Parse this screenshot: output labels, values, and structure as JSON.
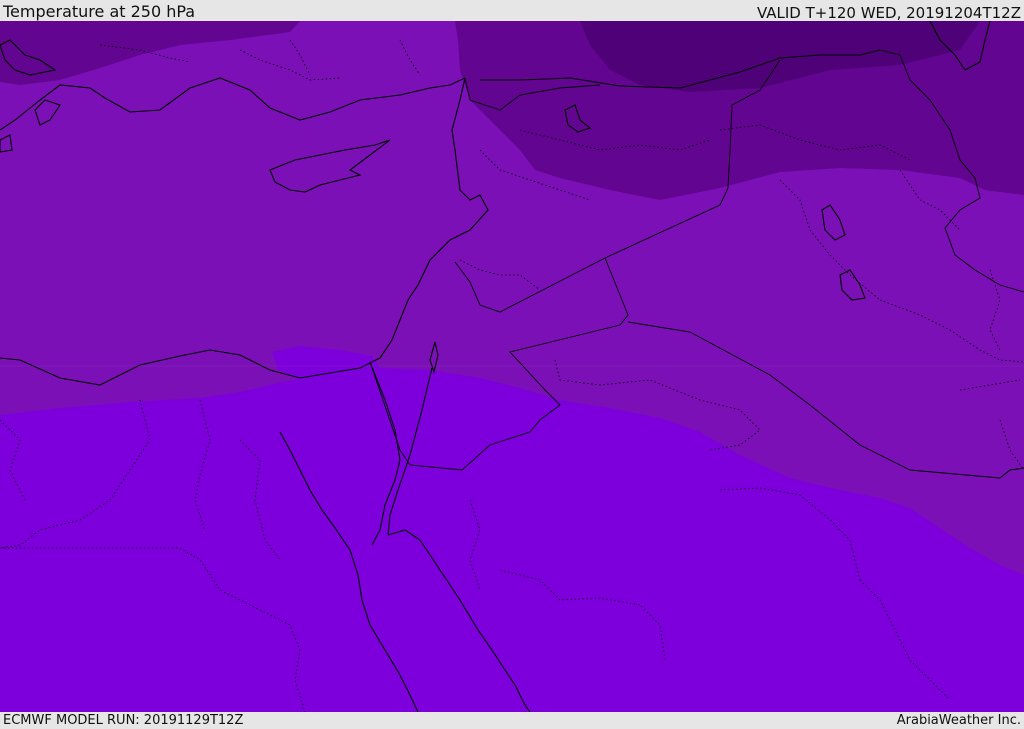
{
  "header": {
    "title": "Temperature at 250 hPa",
    "valid": "VALID T+120 WED, 20191204T12Z"
  },
  "footer": {
    "model_run": "ECMWF MODEL RUN: 20191129T12Z",
    "credit": "ArabiaWeather Inc."
  },
  "map": {
    "field": "temperature_250hPa",
    "region": "Eastern Mediterranean / Middle East",
    "colors": {
      "coldest": "#4f0278",
      "colder": "#620590",
      "mid": "#7b10b6",
      "warm": "#7d00dc",
      "coast": "#000000"
    }
  }
}
